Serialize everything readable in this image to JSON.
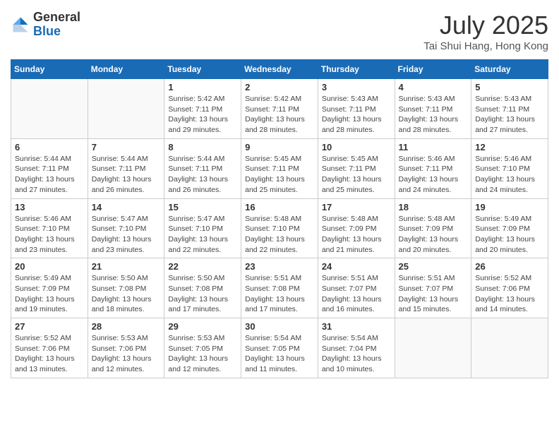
{
  "header": {
    "logo_general": "General",
    "logo_blue": "Blue",
    "month_title": "July 2025",
    "location": "Tai Shui Hang, Hong Kong"
  },
  "weekdays": [
    "Sunday",
    "Monday",
    "Tuesday",
    "Wednesday",
    "Thursday",
    "Friday",
    "Saturday"
  ],
  "weeks": [
    [
      {
        "day": "",
        "sunrise": "",
        "sunset": "",
        "daylight": ""
      },
      {
        "day": "",
        "sunrise": "",
        "sunset": "",
        "daylight": ""
      },
      {
        "day": "1",
        "sunrise": "Sunrise: 5:42 AM",
        "sunset": "Sunset: 7:11 PM",
        "daylight": "Daylight: 13 hours and 29 minutes."
      },
      {
        "day": "2",
        "sunrise": "Sunrise: 5:42 AM",
        "sunset": "Sunset: 7:11 PM",
        "daylight": "Daylight: 13 hours and 28 minutes."
      },
      {
        "day": "3",
        "sunrise": "Sunrise: 5:43 AM",
        "sunset": "Sunset: 7:11 PM",
        "daylight": "Daylight: 13 hours and 28 minutes."
      },
      {
        "day": "4",
        "sunrise": "Sunrise: 5:43 AM",
        "sunset": "Sunset: 7:11 PM",
        "daylight": "Daylight: 13 hours and 28 minutes."
      },
      {
        "day": "5",
        "sunrise": "Sunrise: 5:43 AM",
        "sunset": "Sunset: 7:11 PM",
        "daylight": "Daylight: 13 hours and 27 minutes."
      }
    ],
    [
      {
        "day": "6",
        "sunrise": "Sunrise: 5:44 AM",
        "sunset": "Sunset: 7:11 PM",
        "daylight": "Daylight: 13 hours and 27 minutes."
      },
      {
        "day": "7",
        "sunrise": "Sunrise: 5:44 AM",
        "sunset": "Sunset: 7:11 PM",
        "daylight": "Daylight: 13 hours and 26 minutes."
      },
      {
        "day": "8",
        "sunrise": "Sunrise: 5:44 AM",
        "sunset": "Sunset: 7:11 PM",
        "daylight": "Daylight: 13 hours and 26 minutes."
      },
      {
        "day": "9",
        "sunrise": "Sunrise: 5:45 AM",
        "sunset": "Sunset: 7:11 PM",
        "daylight": "Daylight: 13 hours and 25 minutes."
      },
      {
        "day": "10",
        "sunrise": "Sunrise: 5:45 AM",
        "sunset": "Sunset: 7:11 PM",
        "daylight": "Daylight: 13 hours and 25 minutes."
      },
      {
        "day": "11",
        "sunrise": "Sunrise: 5:46 AM",
        "sunset": "Sunset: 7:11 PM",
        "daylight": "Daylight: 13 hours and 24 minutes."
      },
      {
        "day": "12",
        "sunrise": "Sunrise: 5:46 AM",
        "sunset": "Sunset: 7:10 PM",
        "daylight": "Daylight: 13 hours and 24 minutes."
      }
    ],
    [
      {
        "day": "13",
        "sunrise": "Sunrise: 5:46 AM",
        "sunset": "Sunset: 7:10 PM",
        "daylight": "Daylight: 13 hours and 23 minutes."
      },
      {
        "day": "14",
        "sunrise": "Sunrise: 5:47 AM",
        "sunset": "Sunset: 7:10 PM",
        "daylight": "Daylight: 13 hours and 23 minutes."
      },
      {
        "day": "15",
        "sunrise": "Sunrise: 5:47 AM",
        "sunset": "Sunset: 7:10 PM",
        "daylight": "Daylight: 13 hours and 22 minutes."
      },
      {
        "day": "16",
        "sunrise": "Sunrise: 5:48 AM",
        "sunset": "Sunset: 7:10 PM",
        "daylight": "Daylight: 13 hours and 22 minutes."
      },
      {
        "day": "17",
        "sunrise": "Sunrise: 5:48 AM",
        "sunset": "Sunset: 7:09 PM",
        "daylight": "Daylight: 13 hours and 21 minutes."
      },
      {
        "day": "18",
        "sunrise": "Sunrise: 5:48 AM",
        "sunset": "Sunset: 7:09 PM",
        "daylight": "Daylight: 13 hours and 20 minutes."
      },
      {
        "day": "19",
        "sunrise": "Sunrise: 5:49 AM",
        "sunset": "Sunset: 7:09 PM",
        "daylight": "Daylight: 13 hours and 20 minutes."
      }
    ],
    [
      {
        "day": "20",
        "sunrise": "Sunrise: 5:49 AM",
        "sunset": "Sunset: 7:09 PM",
        "daylight": "Daylight: 13 hours and 19 minutes."
      },
      {
        "day": "21",
        "sunrise": "Sunrise: 5:50 AM",
        "sunset": "Sunset: 7:08 PM",
        "daylight": "Daylight: 13 hours and 18 minutes."
      },
      {
        "day": "22",
        "sunrise": "Sunrise: 5:50 AM",
        "sunset": "Sunset: 7:08 PM",
        "daylight": "Daylight: 13 hours and 17 minutes."
      },
      {
        "day": "23",
        "sunrise": "Sunrise: 5:51 AM",
        "sunset": "Sunset: 7:08 PM",
        "daylight": "Daylight: 13 hours and 17 minutes."
      },
      {
        "day": "24",
        "sunrise": "Sunrise: 5:51 AM",
        "sunset": "Sunset: 7:07 PM",
        "daylight": "Daylight: 13 hours and 16 minutes."
      },
      {
        "day": "25",
        "sunrise": "Sunrise: 5:51 AM",
        "sunset": "Sunset: 7:07 PM",
        "daylight": "Daylight: 13 hours and 15 minutes."
      },
      {
        "day": "26",
        "sunrise": "Sunrise: 5:52 AM",
        "sunset": "Sunset: 7:06 PM",
        "daylight": "Daylight: 13 hours and 14 minutes."
      }
    ],
    [
      {
        "day": "27",
        "sunrise": "Sunrise: 5:52 AM",
        "sunset": "Sunset: 7:06 PM",
        "daylight": "Daylight: 13 hours and 13 minutes."
      },
      {
        "day": "28",
        "sunrise": "Sunrise: 5:53 AM",
        "sunset": "Sunset: 7:06 PM",
        "daylight": "Daylight: 13 hours and 12 minutes."
      },
      {
        "day": "29",
        "sunrise": "Sunrise: 5:53 AM",
        "sunset": "Sunset: 7:05 PM",
        "daylight": "Daylight: 13 hours and 12 minutes."
      },
      {
        "day": "30",
        "sunrise": "Sunrise: 5:54 AM",
        "sunset": "Sunset: 7:05 PM",
        "daylight": "Daylight: 13 hours and 11 minutes."
      },
      {
        "day": "31",
        "sunrise": "Sunrise: 5:54 AM",
        "sunset": "Sunset: 7:04 PM",
        "daylight": "Daylight: 13 hours and 10 minutes."
      },
      {
        "day": "",
        "sunrise": "",
        "sunset": "",
        "daylight": ""
      },
      {
        "day": "",
        "sunrise": "",
        "sunset": "",
        "daylight": ""
      }
    ]
  ]
}
